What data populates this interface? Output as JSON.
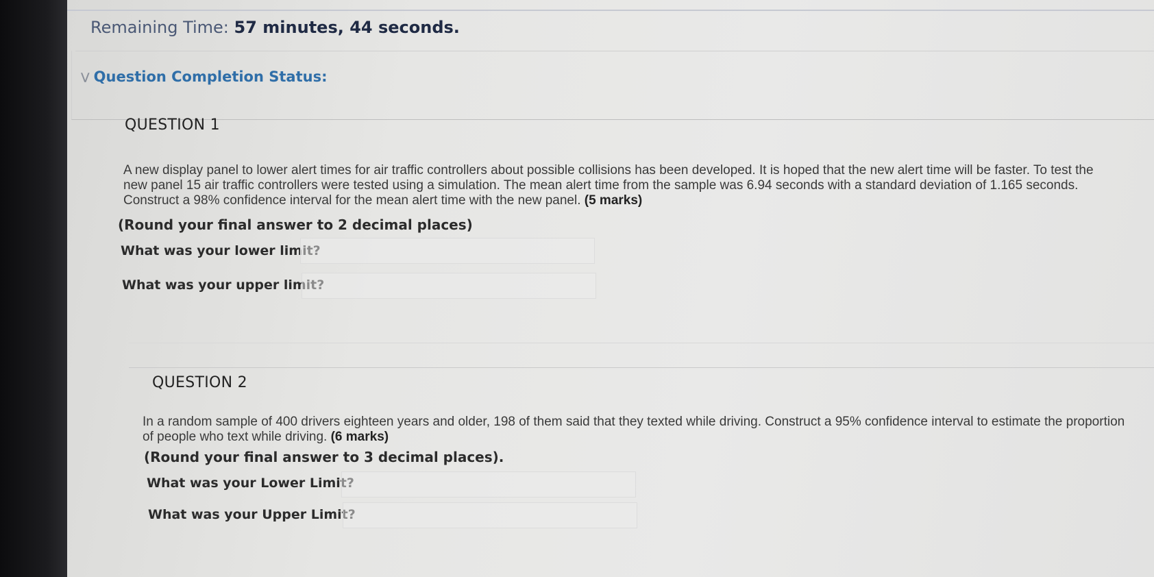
{
  "timer": {
    "label": "Remaining Time:",
    "value": "57 minutes, 44 seconds."
  },
  "status": {
    "chevron_icon": "double-chevron-down-icon",
    "label": "Question Completion Status:"
  },
  "questions": [
    {
      "title": "QUESTION 1",
      "body": "A new display panel to lower alert times for air traffic controllers about possible collisions has been developed. It is hoped that the new alert time will be faster. To test the new panel 15 air traffic controllers were tested using a simulation. The mean alert time from the sample was 6.94 seconds with a standard deviation of 1.165 seconds. Construct a 98% confidence interval for the mean alert time with the new panel.",
      "marks": "(5 marks)",
      "instruction": "(Round your final answer to 2 decimal places)",
      "prompts": [
        "What was your lower limit?",
        "What was your upper limit?"
      ]
    },
    {
      "title": "QUESTION 2",
      "body": "In a random sample of 400 drivers eighteen years and older, 198 of them said that they texted while driving. Construct a 95% confidence interval to estimate the proportion of people who text while driving.",
      "marks": "(6 marks)",
      "instruction": "(Round your final answer to 3 decimal places).",
      "prompts": [
        "What was your Lower Limit?",
        "What was your Upper Limit?"
      ]
    }
  ]
}
